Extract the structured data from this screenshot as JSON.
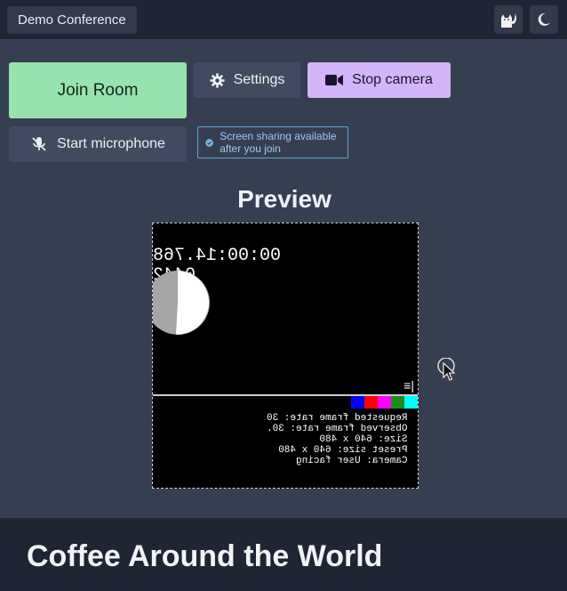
{
  "header": {
    "title": "Demo Conference",
    "theme_icon": "cat-icon",
    "darkmode_icon": "moon-icon"
  },
  "controls": {
    "join_label": "Join Room",
    "settings_label": "Settings",
    "stop_camera_label": "Stop camera",
    "start_mic_label": "Start microphone",
    "screen_note": "Screen sharing available after you join"
  },
  "preview": {
    "title": "Preview",
    "clock": "00:00:14.768",
    "frame_count": "0442",
    "stats": [
      "Requested frame rate: 30",
      "Observed frame rate: 30.",
      "Size: 640 x 480",
      "Preset size: 640 x 480",
      "Camera: User facing"
    ],
    "color_bars": [
      "#00ffff",
      "#1e8a1e",
      "#ff00ff",
      "#ff0000",
      "#0000ff"
    ]
  },
  "footer": {
    "title": "Coffee Around the World"
  },
  "colors": {
    "join": "#98e2af",
    "stop_camera": "#d4b5f7",
    "note_border": "#5fa6d6"
  }
}
